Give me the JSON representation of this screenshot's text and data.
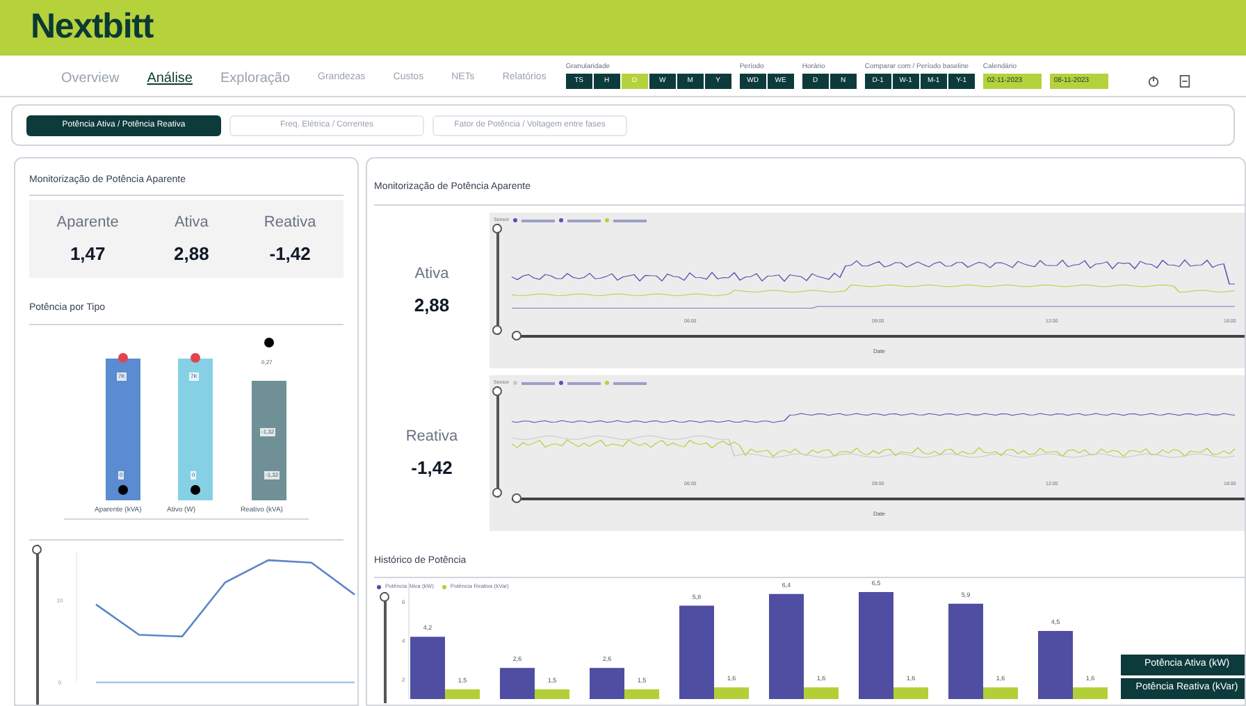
{
  "header": {
    "logo": "Nextbitt"
  },
  "nav": [
    {
      "label": "Overview",
      "selected": false
    },
    {
      "label": "Análise",
      "selected": true
    },
    {
      "label": "Exploração",
      "selected": false
    },
    {
      "label": "Grandezas",
      "selected": false
    },
    {
      "label": "Custos",
      "selected": false
    },
    {
      "label": "NETs",
      "selected": false
    },
    {
      "label": "Relatórios",
      "selected": false
    }
  ],
  "filters": [
    {
      "label": "Granularidade",
      "options": [
        {
          "label": "TS",
          "selected": false
        },
        {
          "label": "H",
          "selected": false
        },
        {
          "label": "D",
          "selected": true
        },
        {
          "label": "W",
          "selected": false
        },
        {
          "label": "M",
          "selected": false
        },
        {
          "label": "Y",
          "selected": false
        }
      ]
    },
    {
      "label": "Período",
      "options": [
        {
          "label": "WD",
          "selected": false
        },
        {
          "label": "WE",
          "selected": false
        }
      ]
    },
    {
      "label": "Horário",
      "options": [
        {
          "label": "D",
          "selected": false
        },
        {
          "label": "N",
          "selected": false
        }
      ]
    },
    {
      "label": "Comparar com / Período baseline",
      "options": [
        {
          "label": "D-1",
          "selected": false
        },
        {
          "label": "W-1",
          "selected": false
        },
        {
          "label": "M-1",
          "selected": false
        },
        {
          "label": "Y-1",
          "selected": false
        }
      ]
    }
  ],
  "calendar": {
    "label": "Calendário",
    "from": "02-11-2023",
    "to": "08-11-2023"
  },
  "page_tabs": [
    {
      "label": "Potência Ativa / Potência Reativa",
      "selected": true
    },
    {
      "label": "Freq. Elétrica / Correntes",
      "selected": false
    },
    {
      "label": "Fator de Potência / Voltagem entre fases",
      "selected": false
    }
  ],
  "summary": {
    "title": "Monitorização de Potência Aparente",
    "metrics": [
      {
        "label": "Aparente",
        "value": "1,47"
      },
      {
        "label": "Ativa",
        "value": "2,88"
      },
      {
        "label": "Reativa",
        "value": "-1,42"
      }
    ]
  },
  "type_chart": {
    "title": "Potência por Tipo",
    "bars": [
      {
        "label": "Aparente (kVA)",
        "color": "#5b8bd0",
        "top_label": "7K",
        "bottom_label": "0"
      },
      {
        "label": "Ativo (W)",
        "color": "#86d0e6",
        "top_label": "7K",
        "bottom_label": "0"
      },
      {
        "label": "Reativo (kVA)",
        "color": "#6f9096",
        "top_label": "0,27",
        "mid_label": "-1,32",
        "bottom_label": "-1,32"
      }
    ]
  },
  "trend": {
    "slider": {
      "level": 1
    },
    "chart_data": {
      "type": "line",
      "categories": [
        null,
        null,
        null,
        null,
        null,
        null,
        null
      ],
      "series": [
        {
          "color": "#5b86c8",
          "values": [
            9.5,
            5.8,
            5.6,
            12.2,
            14.9,
            14.6,
            10.7
          ]
        },
        {
          "color": "#a9c3e6",
          "values": [
            0,
            0,
            0,
            0,
            0,
            0,
            0
          ]
        }
      ],
      "ylim": [
        0,
        16
      ],
      "yticks": [
        0,
        10
      ]
    }
  },
  "monitor": {
    "title": "Monitorização de Potência Aparente",
    "rows": [
      {
        "label": "Ativa",
        "value": "2,88",
        "legend_title": "Sensor",
        "legend": [
          {
            "color": "#5a4fb0"
          },
          {
            "color": "#5a4fb0"
          },
          {
            "color": "#b9d03c"
          }
        ],
        "xticks": [
          "06:00",
          "09:00",
          "12:00",
          "18:00"
        ],
        "xlabel": "Date",
        "v_slider": {
          "level": 1
        },
        "h_slider": {
          "level": 1
        }
      },
      {
        "label": "Reativa",
        "value": "-1,42",
        "legend_title": "Sensor",
        "legend": [
          {
            "color": "#c8c8c8"
          },
          {
            "color": "#5a4fb0"
          },
          {
            "color": "#b9d03c"
          }
        ],
        "xticks": [
          "06:00",
          "09:00",
          "12:00",
          "18:00"
        ],
        "xlabel": "Date",
        "v_slider": {
          "level": 1
        },
        "h_slider": {
          "level": 1
        }
      }
    ]
  },
  "history": {
    "title": "Histórico de Potência",
    "buttons": [
      "Potência Ativa (kW)",
      "Potência Reativa (kVar)"
    ],
    "slider": {
      "level": 1
    },
    "chart_data": {
      "type": "bar",
      "legend": "top",
      "categories": [
        null,
        null,
        null,
        null,
        null,
        null,
        null,
        null
      ],
      "series": [
        {
          "name": "Potência Ativa (kW)",
          "color": "#4f4ea3",
          "values": [
            4.2,
            2.6,
            2.6,
            5.8,
            6.4,
            6.5,
            5.9,
            4.5
          ]
        },
        {
          "name": "Potência Reativa (kVar)",
          "color": "#b3cf37",
          "values": [
            1.5,
            1.5,
            1.5,
            1.6,
            1.6,
            1.6,
            1.6,
            1.6
          ]
        }
      ],
      "ylim": [
        1,
        7
      ],
      "yticks": [
        2,
        4,
        6
      ],
      "value_labels": [
        [
          "4,2",
          "2,6",
          "2,6",
          "5,8",
          "6,4",
          "6,5",
          "5,9",
          "4,5"
        ],
        [
          "1,5",
          "1,5",
          "1,5",
          "1,6",
          "1,6",
          "1,6",
          "1,6",
          "1,6"
        ]
      ]
    }
  }
}
